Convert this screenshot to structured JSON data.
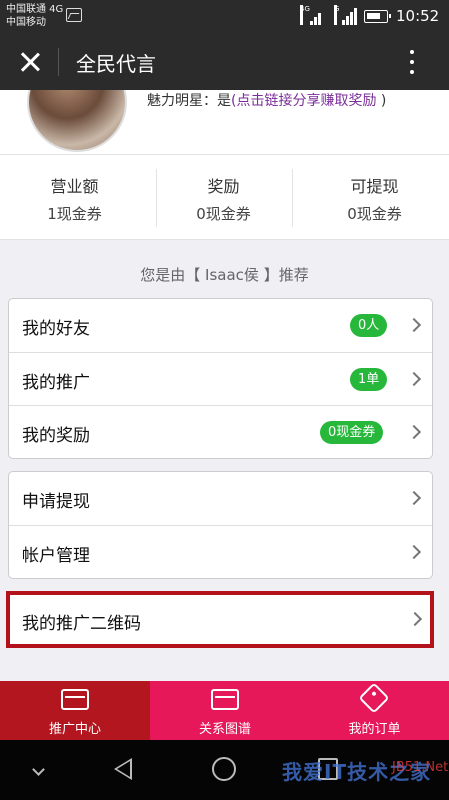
{
  "status": {
    "carrier_line1": "中国联通 4G",
    "carrier_line2": "中国移动",
    "net1": "4G",
    "net2": "G",
    "time": "10:52"
  },
  "header": {
    "title": "全民代言"
  },
  "profile": {
    "charm_label": "魅力明星：是",
    "charm_link": "(点击链接分享赚取奖励",
    "charm_close": " )"
  },
  "stats": [
    {
      "label": "营业额",
      "value": "1现金券"
    },
    {
      "label": "奖励",
      "value": "0现金券"
    },
    {
      "label": "可提现",
      "value": "0现金券"
    }
  ],
  "referrer": "您是由【 Isaac侯 】推荐",
  "menu_group1": [
    {
      "label": "我的好友",
      "badge": "0人"
    },
    {
      "label": "我的推广",
      "badge": "1单"
    },
    {
      "label": "我的奖励",
      "badge": "0现金券"
    }
  ],
  "menu_group2": [
    {
      "label": "申请提现"
    },
    {
      "label": "帐户管理"
    }
  ],
  "qr_item": {
    "label": "我的推广二维码"
  },
  "tabs": [
    {
      "label": "推广中心",
      "active": true
    },
    {
      "label": "关系图谱",
      "active": false
    },
    {
      "label": "我的订单",
      "active": false
    }
  ],
  "watermark": {
    "text": "我爱IT技术之家",
    "sub": "JB51.Net"
  },
  "colors": {
    "accent_red": "#b3121b",
    "tab_pink": "#e6185a",
    "badge_green": "#27b83b",
    "link_purple": "#7b2d9a"
  }
}
